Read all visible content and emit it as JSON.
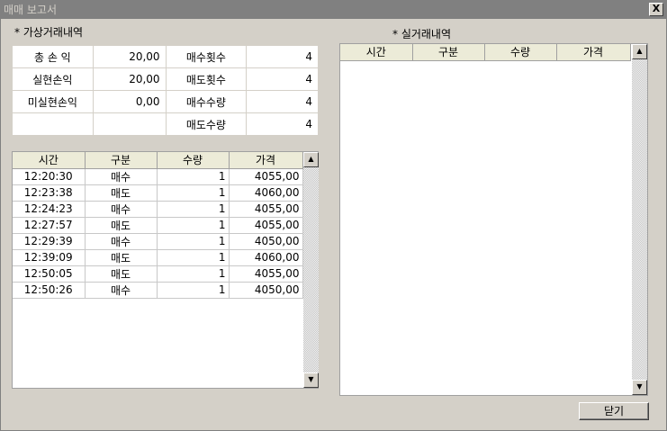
{
  "window": {
    "title": "매매 보고서",
    "close_glyph": "X"
  },
  "virtual_section_label": "* 가상거래내역",
  "real_section_label": "* 실거래내역",
  "summary": {
    "rows": [
      {
        "label1": "총 손 익",
        "value1": "20,00",
        "label2": "매수횟수",
        "value2": "4"
      },
      {
        "label1": "실현손익",
        "value1": "20,00",
        "label2": "매도횟수",
        "value2": "4"
      },
      {
        "label1": "미실현손익",
        "value1": "0,00",
        "label2": "매수수량",
        "value2": "4"
      },
      {
        "label1": "",
        "value1": "",
        "label2": "매도수량",
        "value2": "4"
      }
    ]
  },
  "columns": [
    "시간",
    "구분",
    "수량",
    "가격"
  ],
  "virtual_trades": [
    {
      "time": "12:20:30",
      "type": "매수",
      "qty": "1",
      "price": "4055,00"
    },
    {
      "time": "12:23:38",
      "type": "매도",
      "qty": "1",
      "price": "4060,00"
    },
    {
      "time": "12:24:23",
      "type": "매수",
      "qty": "1",
      "price": "4055,00"
    },
    {
      "time": "12:27:57",
      "type": "매도",
      "qty": "1",
      "price": "4055,00"
    },
    {
      "time": "12:29:39",
      "type": "매수",
      "qty": "1",
      "price": "4050,00"
    },
    {
      "time": "12:39:09",
      "type": "매도",
      "qty": "1",
      "price": "4060,00"
    },
    {
      "time": "12:50:05",
      "type": "매도",
      "qty": "1",
      "price": "4055,00"
    },
    {
      "time": "12:50:26",
      "type": "매수",
      "qty": "1",
      "price": "4050,00"
    }
  ],
  "real_trades": [],
  "buttons": {
    "close_label": "닫기"
  },
  "scroll_glyphs": {
    "up": "▲",
    "down": "▼"
  }
}
